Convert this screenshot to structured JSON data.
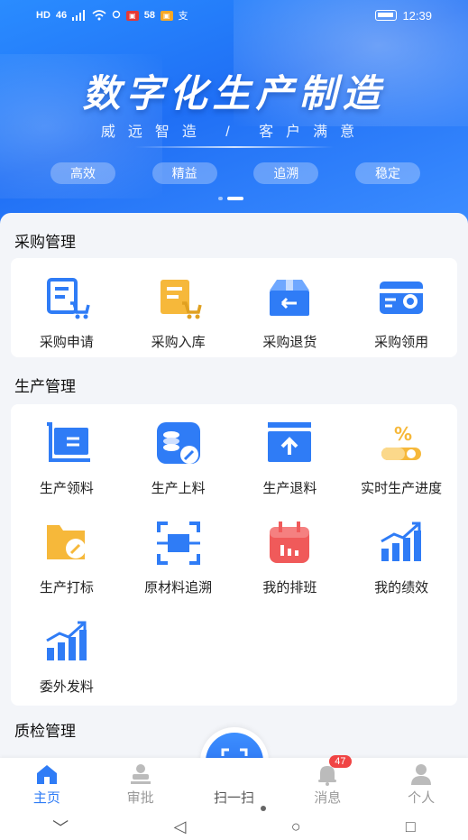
{
  "status_bar": {
    "left": [
      "HD",
      "46",
      "58"
    ],
    "time": "12:39"
  },
  "banner": {
    "title": "数字化生产制造",
    "subtitle": "威远智造 / 客户满意",
    "tags": [
      "高效",
      "精益",
      "追溯",
      "稳定"
    ]
  },
  "sections": [
    {
      "title": "采购管理",
      "items": [
        {
          "label": "采购申请",
          "icon": "purchase-request-icon"
        },
        {
          "label": "采购入库",
          "icon": "purchase-inbound-icon"
        },
        {
          "label": "采购退货",
          "icon": "purchase-return-icon"
        },
        {
          "label": "采购领用",
          "icon": "purchase-use-icon"
        }
      ]
    },
    {
      "title": "生产管理",
      "items": [
        {
          "label": "生产领料",
          "icon": "production-pick-icon"
        },
        {
          "label": "生产上料",
          "icon": "production-feed-icon"
        },
        {
          "label": "生产退料",
          "icon": "production-return-icon"
        },
        {
          "label": "实时生产进度",
          "icon": "production-progress-icon"
        },
        {
          "label": "生产打标",
          "icon": "production-label-icon"
        },
        {
          "label": "原材料追溯",
          "icon": "material-trace-icon"
        },
        {
          "label": "我的排班",
          "icon": "my-schedule-icon"
        },
        {
          "label": "我的绩效",
          "icon": "my-performance-icon"
        },
        {
          "label": "委外发料",
          "icon": "outsource-issue-icon"
        }
      ]
    },
    {
      "title": "质检管理"
    }
  ],
  "bottom_nav": {
    "items": [
      {
        "label": "主页",
        "icon": "home-icon",
        "active": true
      },
      {
        "label": "审批",
        "icon": "approval-icon"
      },
      {
        "label": "扫一扫",
        "icon": "scan-icon"
      },
      {
        "label": "消息",
        "icon": "bell-icon",
        "badge": "47"
      },
      {
        "label": "个人",
        "icon": "person-icon"
      }
    ]
  },
  "colors": {
    "primary": "#2f7cf6",
    "orange": "#f6b83a",
    "red": "#f05a5a"
  }
}
